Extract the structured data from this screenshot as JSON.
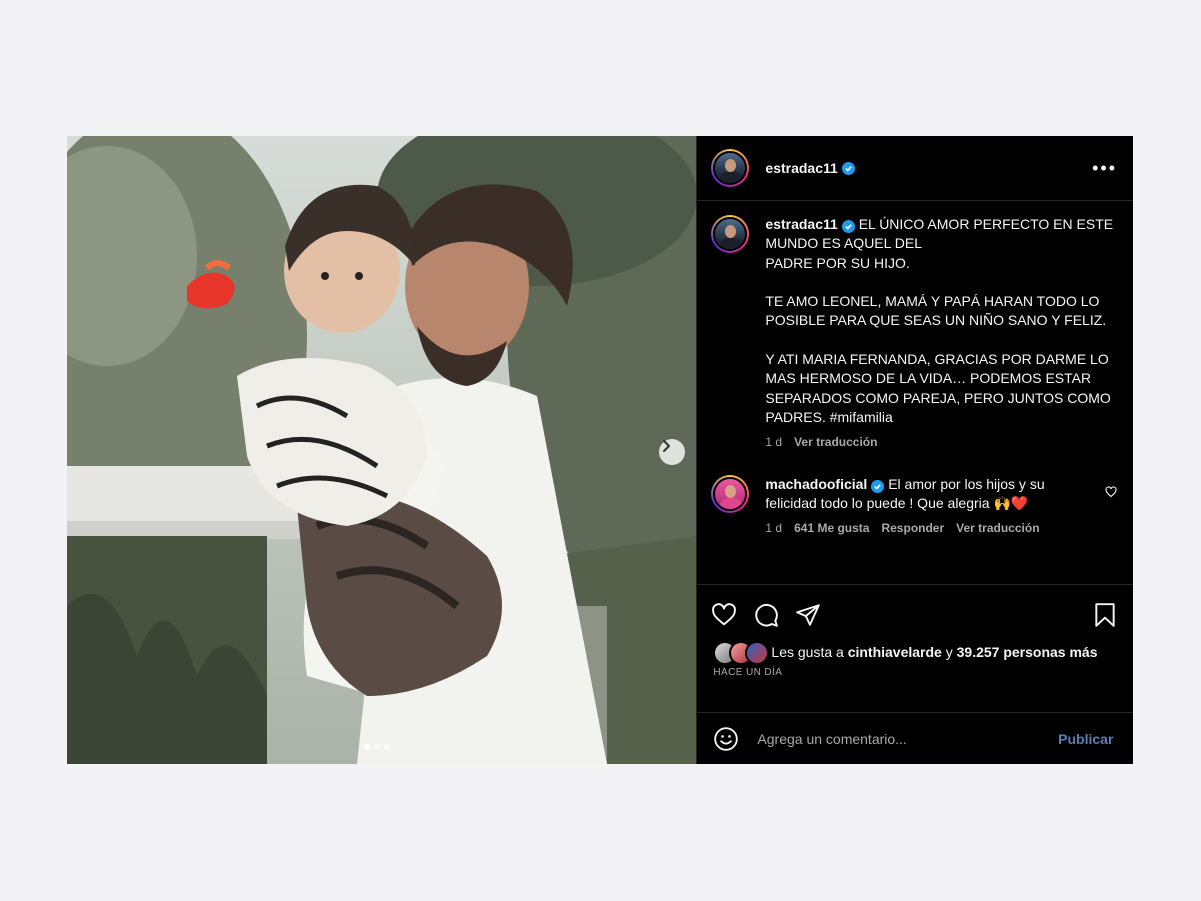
{
  "post": {
    "author": "estradac11",
    "caption": "EL ÚNICO AMOR PERFECTO EN ESTE MUNDO ES AQUEL DEL\nPADRE POR SU HIJO.\n\nTE AMO LEONEL, MAMÁ Y PAPÁ HARAN TODO LO POSIBLE PARA QUE SEAS UN NIÑO SANO Y FELIZ.\n\nY ATI MARIA FERNANDA, GRACIAS POR DARME LO MAS HERMOSO DE LA VIDA… PODEMOS ESTAR SEPARADOS COMO PAREJA, PERO JUNTOS COMO PADRES. #mifamilia",
    "caption_age": "1 d",
    "caption_translate": "Ver traducción",
    "carousel_dots": 3,
    "carousel_active": 0
  },
  "comment": {
    "author": "machadooficial",
    "text": "El amor por los hijos y su felicidad todo lo puede ! Que alegria 🙌❤️",
    "age": "1 d",
    "likes": "641 Me gusta",
    "reply": "Responder",
    "translate": "Ver traducción"
  },
  "likes": {
    "prefix": "Les gusta a",
    "user": "cinthiavelarde",
    "joiner": "y",
    "others": "39.257 personas más"
  },
  "timestamp": "HACE UN DÍA",
  "composer": {
    "placeholder": "Agrega un comentario...",
    "publish": "Publicar"
  },
  "colors": {
    "verified": "#1d9bf0",
    "publish": "#5a7fb2",
    "meta": "#a8a8a8"
  },
  "icons": [
    "heart-icon",
    "comment-icon",
    "share-icon",
    "bookmark-icon",
    "emoji-icon",
    "more-icon",
    "verified-icon",
    "chevron-right-icon"
  ]
}
